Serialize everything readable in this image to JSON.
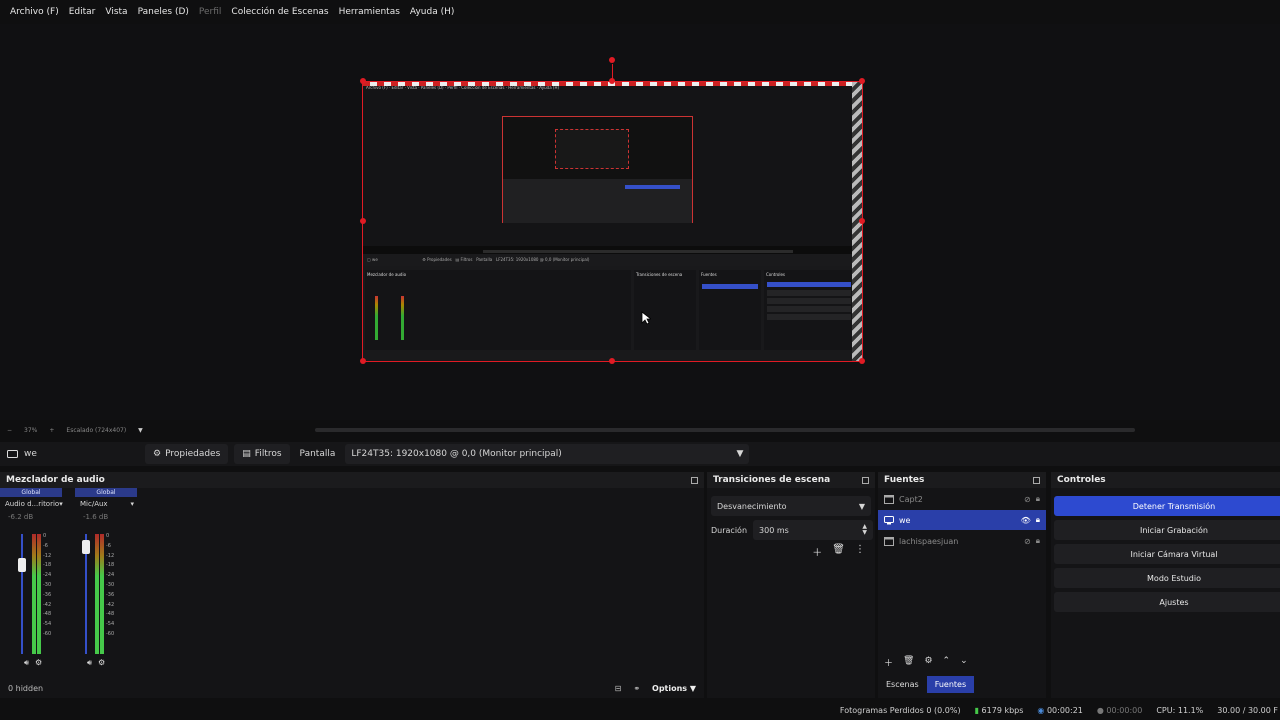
{
  "menu": [
    "Archivo (F)",
    "Editar",
    "Vista",
    "Paneles (D)",
    "Perfil",
    "Colección de Escenas",
    "Herramientas",
    "Ayuda (H)"
  ],
  "zoom": {
    "minus": "−",
    "percent": "37%",
    "plus": "+",
    "scaling": "Escalado (724x407)"
  },
  "source_toolbar": {
    "source_name": "we",
    "properties": "Propiedades",
    "filters": "Filtros",
    "display_label": "Pantalla",
    "display_value": "LF24T35: 1920x1080 @ 0,0 (Monitor principal)"
  },
  "mixer": {
    "title": "Mezclador de audio",
    "scale": [
      "0",
      "-6",
      "-12",
      "-18",
      "-24",
      "-30",
      "-36",
      "-42",
      "-48",
      "-54",
      "-60"
    ],
    "channels": [
      {
        "badge": "Global",
        "name": "Audio d...ritorio",
        "db": "-6.2 dB",
        "level": 0.82
      },
      {
        "badge": "Global",
        "name": "Mic/Aux",
        "db": "-1.6 dB",
        "level": 0.92
      }
    ],
    "hidden": "0 hidden",
    "options": "Options"
  },
  "transitions": {
    "title": "Transiciones de escena",
    "selected": "Desvanecimiento",
    "duration_label": "Duración",
    "duration_value": "300 ms"
  },
  "sources": {
    "title": "Fuentes",
    "items": [
      {
        "name": "Capt2",
        "selected": false,
        "visible": false
      },
      {
        "name": "we",
        "selected": true,
        "visible": true
      },
      {
        "name": "lachispaesjuan",
        "selected": false,
        "visible": false
      }
    ],
    "tabs": [
      "Escenas",
      "Fuentes"
    ],
    "active_tab": "Fuentes"
  },
  "controls": {
    "title": "Controles",
    "buttons": [
      "Detener Transmisión",
      "Iniciar Grabación",
      "Iniciar Cámara Virtual",
      "Modo Estudio",
      "Ajustes"
    ]
  },
  "status": {
    "dropped": "Fotogramas Perdidos 0 (0.0%)",
    "bitrate": "6179 kbps",
    "stream_time": "00:00:21",
    "rec_time": "00:00:00",
    "cpu": "CPU: 11.1%",
    "fps": "30.00 / 30.00 F"
  },
  "colors": {
    "accent": "#2d4ad0",
    "selection": "#e01b24",
    "meter_green": "#46c94a"
  }
}
